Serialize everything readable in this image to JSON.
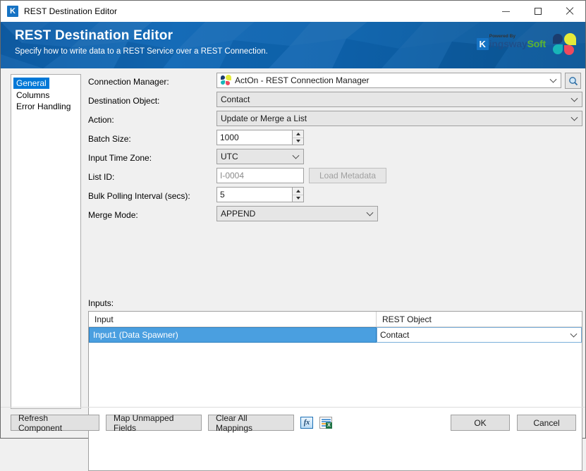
{
  "window": {
    "title": "REST Destination Editor",
    "app_icon": "kingswaysoft-k-icon",
    "minimize_label": "Minimize",
    "maximize_label": "Maximize",
    "close_label": "Close"
  },
  "banner": {
    "title": "REST Destination Editor",
    "subtitle": "Specify how to write data to a REST Service over a REST Connection.",
    "brand": {
      "powered_by": "Powered By",
      "k": "K",
      "kingsway": "ingsway",
      "soft": "Soft"
    }
  },
  "sidebar": {
    "items": [
      {
        "label": "General",
        "selected": true
      },
      {
        "label": "Columns",
        "selected": false
      },
      {
        "label": "Error Handling",
        "selected": false
      }
    ]
  },
  "form": {
    "connection_manager": {
      "label": "Connection Manager:",
      "value": "ActOn - REST Connection Manager",
      "search_button": "search-icon"
    },
    "destination_object": {
      "label": "Destination Object:",
      "value": "Contact"
    },
    "action": {
      "label": "Action:",
      "value": "Update or Merge a List"
    },
    "batch_size": {
      "label": "Batch Size:",
      "value": "1000"
    },
    "input_time_zone": {
      "label": "Input Time Zone:",
      "value": "UTC"
    },
    "list_id": {
      "label": "List ID:",
      "value": "I-0004",
      "load_metadata_button": "Load Metadata"
    },
    "bulk_polling_interval": {
      "label": "Bulk Polling Interval (secs):",
      "value": "5"
    },
    "merge_mode": {
      "label": "Merge Mode:",
      "value": "APPEND"
    }
  },
  "inputs": {
    "label": "Inputs:",
    "columns": [
      "Input",
      "REST Object"
    ],
    "rows": [
      {
        "input": "Input1 (Data Spawner)",
        "rest_object": "Contact",
        "selected": true
      }
    ]
  },
  "footer": {
    "refresh_component": "Refresh Component",
    "map_unmapped_fields": "Map Unmapped Fields",
    "clear_all_mappings": "Clear All Mappings",
    "fx_button": "fx",
    "export_button": "export-grid-icon",
    "ok": "OK",
    "cancel": "Cancel"
  },
  "colors": {
    "banner_blue": "#0f63ad",
    "selection_blue": "#0078d7",
    "row_highlight": "#4a9fe0",
    "brand_green": "#5bb431"
  }
}
